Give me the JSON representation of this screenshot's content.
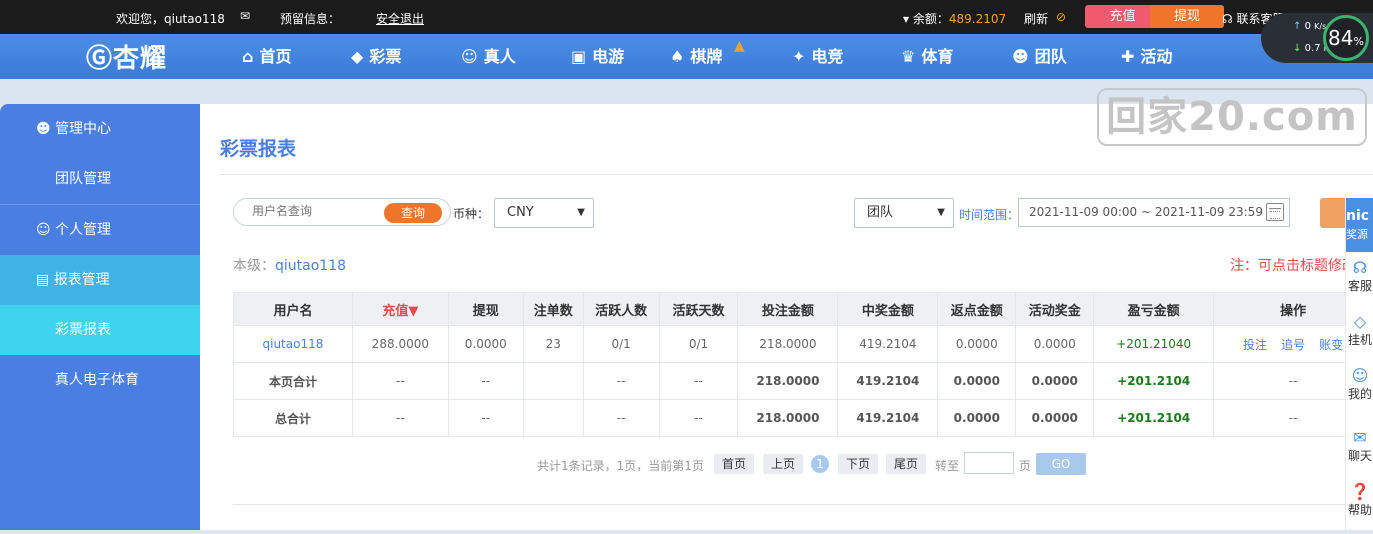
{
  "topbar": {
    "welcome": "欢迎您，qiutao118",
    "reserve_info": "预留信息：",
    "logout": "安全退出",
    "balance_label": "余额：",
    "balance_value": "489.2107",
    "refresh": "刷新",
    "recharge": "充值",
    "withdraw": "提现",
    "customer_service": "联系客服"
  },
  "speed_widget": {
    "up": "0",
    "down": "0.7",
    "unit": "K/s",
    "percent": "84",
    "percent_sign": "%"
  },
  "logo": "杏耀",
  "nav": [
    {
      "label": "首页",
      "icon": "home-icon",
      "glyph": "⌂"
    },
    {
      "label": "彩票",
      "icon": "ticket-icon",
      "glyph": "◆"
    },
    {
      "label": "真人",
      "icon": "person-icon",
      "glyph": "☺"
    },
    {
      "label": "电游",
      "icon": "slot-icon",
      "glyph": "▣"
    },
    {
      "label": "棋牌",
      "icon": "cards-icon",
      "glyph": "♠"
    },
    {
      "label": "电竞",
      "icon": "gamepad-icon",
      "glyph": "✦"
    },
    {
      "label": "体育",
      "icon": "trophy-icon",
      "glyph": "♛"
    },
    {
      "label": "团队",
      "icon": "team-icon",
      "glyph": "☻"
    },
    {
      "label": "活动",
      "icon": "gift-icon",
      "glyph": "✚"
    }
  ],
  "watermark": "回家20.com",
  "sidebar": {
    "management_center": "管理中心",
    "team_management": "团队管理",
    "personal_management": "个人管理",
    "report_management": "报表管理",
    "lottery_report": "彩票报表",
    "live_electronic_sports": "真人电子体育"
  },
  "main": {
    "title": "彩票报表",
    "search_placeholder": "用户名查询",
    "search_button": "查询",
    "currency_label": "币种：",
    "currency_value": "CNY",
    "scope_value": "团队",
    "time_range_label": "时间范围：",
    "time_range_value": "2021-11-09 00:00 ~ 2021-11-09 23:59",
    "level_label": "本级：",
    "level_user": "qiutao118",
    "note": "注：可点击标题修改"
  },
  "table": {
    "headers": [
      "用户名",
      "充值▼",
      "提现",
      "注单数",
      "活跃人数",
      "活跃天数",
      "投注金额",
      "中奖金额",
      "返点金额",
      "活动奖金",
      "盈亏金额",
      "操作"
    ],
    "row": {
      "user": "qiutao118",
      "recharge": "288.0000",
      "withdraw": "0.0000",
      "orders": "23",
      "active_users": "0/1",
      "active_days": "0/1",
      "bet": "218.0000",
      "win": "419.2104",
      "rebate": "0.0000",
      "bonus": "0.0000",
      "pnl": "+201.21040",
      "op1": "投注",
      "op2": "追号",
      "op3": "账变"
    },
    "page_total": {
      "label": "本页合计",
      "recharge": "--",
      "withdraw": "--",
      "active_users": "--",
      "active_days": "--",
      "bet": "218.0000",
      "win": "419.2104",
      "rebate": "0.0000",
      "bonus": "0.0000",
      "pnl": "+201.2104",
      "op": "--"
    },
    "grand_total": {
      "label": "总合计",
      "recharge": "--",
      "withdraw": "--",
      "active_users": "--",
      "active_days": "--",
      "bet": "218.0000",
      "win": "419.2104",
      "rebate": "0.0000",
      "bonus": "0.0000",
      "pnl": "+201.2104",
      "op": "--"
    }
  },
  "pager": {
    "summary": "共计1条记录，1页，当前第1页",
    "first": "首页",
    "prev": "上页",
    "current": "1",
    "next": "下页",
    "last": "尾页",
    "goto": "转至",
    "page_unit": "页",
    "go": "GO"
  },
  "right_side": {
    "top": "nic",
    "top_label": "奖源",
    "items": [
      "客服",
      "挂机",
      "我的",
      "聊天",
      "帮助"
    ]
  }
}
